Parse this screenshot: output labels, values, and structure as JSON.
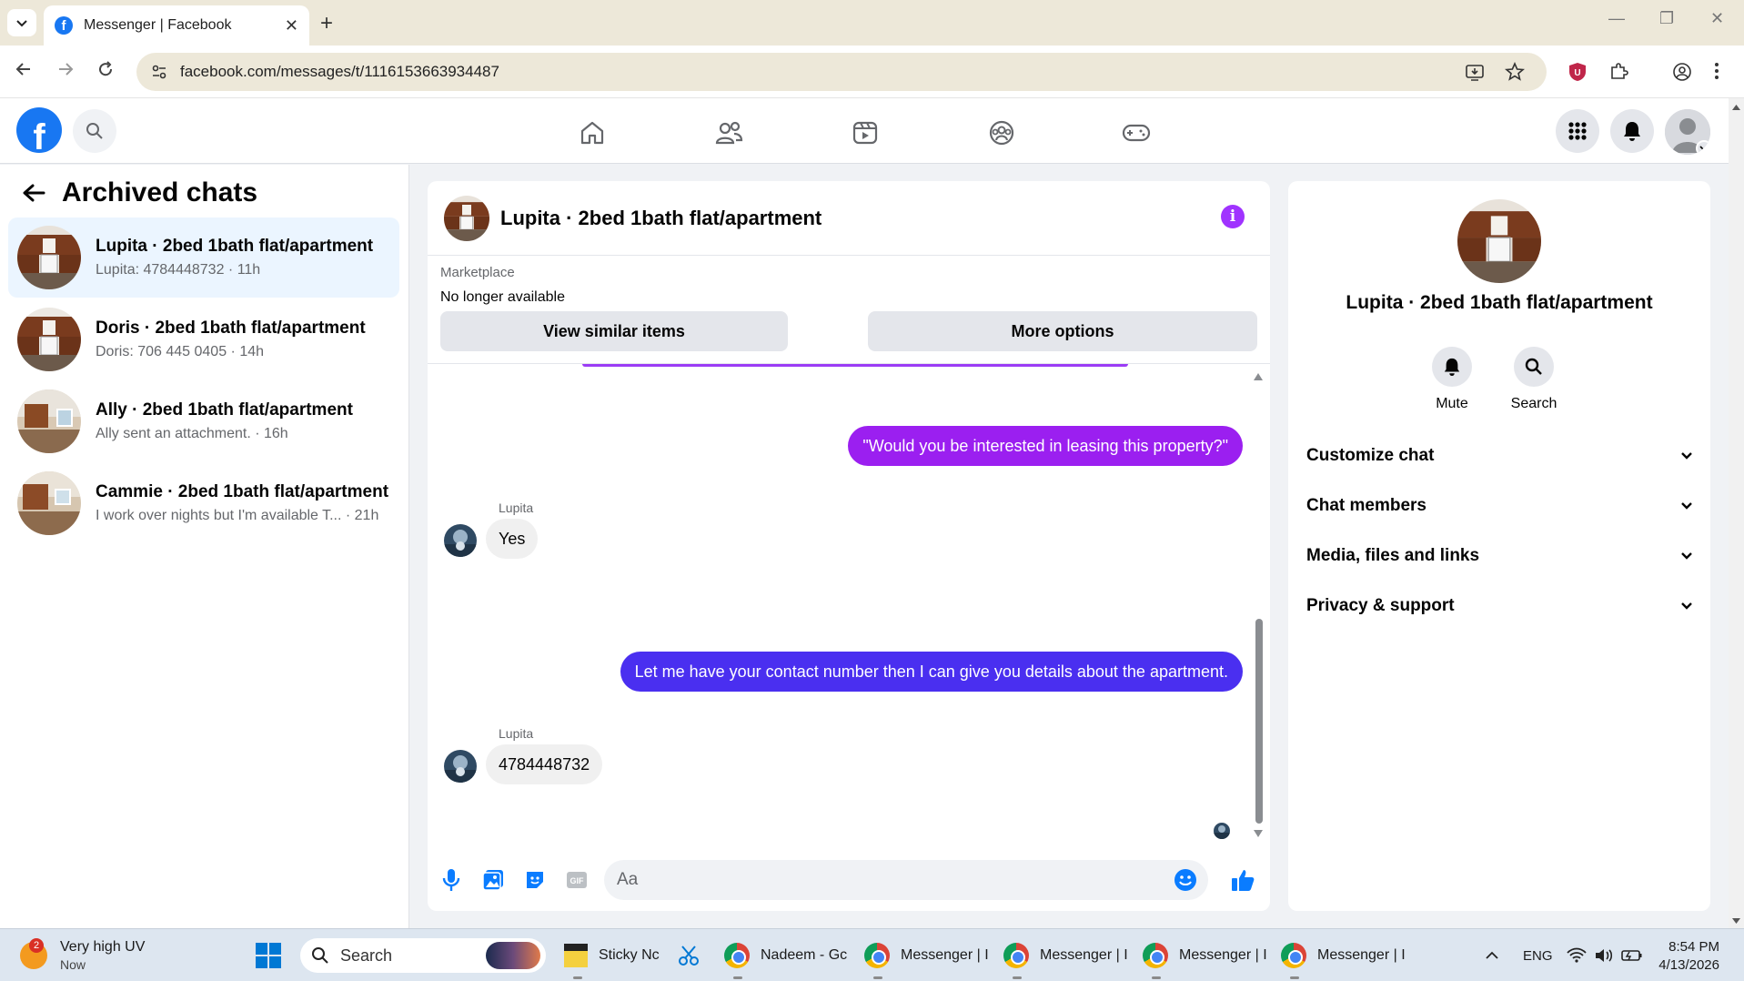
{
  "browser": {
    "tab_title": "Messenger | Facebook",
    "url": "facebook.com/messages/t/1116153663934487"
  },
  "left": {
    "title": "Archived chats",
    "chats": [
      {
        "name": "Lupita · 2bed 1bath flat/apartment",
        "preview": "Lupita: 4784448732 · 11h"
      },
      {
        "name": "Doris · 2bed 1bath flat/apartment",
        "preview": "Doris: 706 445 0405 · 14h"
      },
      {
        "name": "Ally · 2bed 1bath flat/apartment",
        "preview": "Ally sent an attachment. · 16h"
      },
      {
        "name": "Cammie · 2bed 1bath flat/apartment",
        "preview": "I work over nights but I'm available T... · 21h"
      }
    ]
  },
  "conversation": {
    "title": "Lupita · 2bed 1bath flat/apartment",
    "marketplace_label": "Marketplace",
    "status": "No longer available",
    "btn_similar": "View similar items",
    "btn_more": "More options",
    "messages": [
      {
        "from": "me",
        "text": "\"Would you be interested in leasing this property?\"",
        "color": "#9b1ff0"
      },
      {
        "from": "Lupita",
        "sender": "Lupita",
        "text": "Yes"
      },
      {
        "from": "me",
        "text": "Let me have your contact number then I can give you details about the apartment.",
        "color": "#4a2ff0"
      },
      {
        "from": "Lupita",
        "sender": "Lupita",
        "text": "4784448732"
      }
    ],
    "input_placeholder": "Aa"
  },
  "right": {
    "name": "Lupita · 2bed 1bath flat/apartment",
    "mute": "Mute",
    "search": "Search",
    "sections": [
      "Customize chat",
      "Chat members",
      "Media, files and links",
      "Privacy & support"
    ]
  },
  "taskbar": {
    "weather_title": "Very high UV",
    "weather_sub": "Now",
    "weather_badge": "2",
    "search": "Search",
    "apps": [
      "Sticky Nc",
      "Nadeem - Gc",
      "Messenger | I",
      "Messenger | I",
      "Messenger | I",
      "Messenger | I"
    ],
    "lang": "ENG",
    "time": "8:54 PM",
    "date": "4/13/2026"
  },
  "colors": {
    "fb_blue": "#1877f2",
    "accent_purple": "#a033ff",
    "outgoing_purple": "#9b1ff0",
    "outgoing_blue": "#4a2ff0"
  }
}
